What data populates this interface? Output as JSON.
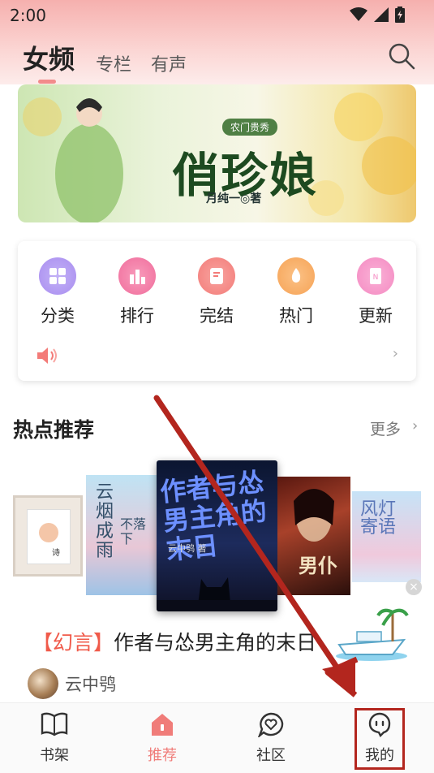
{
  "status_bar": {
    "time": "2:00"
  },
  "header": {
    "tabs": [
      {
        "label": "女频"
      },
      {
        "label": "专栏"
      },
      {
        "label": "有声"
      }
    ]
  },
  "banner": {
    "subtitle": "农门贵秀",
    "title": "俏珍娘",
    "author": "月纯一◎著"
  },
  "menu": {
    "items": [
      {
        "label": "分类",
        "icon": "grid-icon",
        "color": "#a98df0"
      },
      {
        "label": "排行",
        "icon": "bar-chart-icon",
        "color": "#f06d9c"
      },
      {
        "label": "完结",
        "icon": "document-check-icon",
        "color": "#f37b78"
      },
      {
        "label": "热门",
        "icon": "flame-icon",
        "color": "#f6a356"
      },
      {
        "label": "更新",
        "icon": "notebook-icon",
        "color": "#f58ac2"
      }
    ]
  },
  "hot_section": {
    "title": "热点推荐",
    "more": "更多"
  },
  "books": [
    {
      "title": "诗"
    },
    {
      "title": "云烟成雨",
      "subtitle": "不落下"
    },
    {
      "title": "作者与怂男主角的末日",
      "author": "云中鸮 著"
    },
    {
      "title": "男仆"
    },
    {
      "title": "风灯寄语"
    }
  ],
  "featured": {
    "genre": "【幻言】",
    "title": "作者与怂男主角的末日",
    "author": "云中鸮"
  },
  "bottom_nav": {
    "items": [
      {
        "label": "书架"
      },
      {
        "label": "推荐",
        "active": true
      },
      {
        "label": "社区"
      },
      {
        "label": "我的"
      }
    ]
  },
  "colors": {
    "accent": "#f07c79",
    "annotation": "#b3261e"
  }
}
